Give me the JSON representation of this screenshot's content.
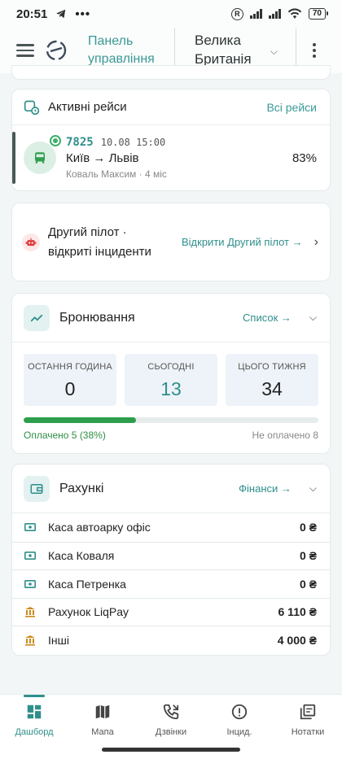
{
  "status_bar": {
    "time": "20:51",
    "battery": "70"
  },
  "header": {
    "tab_label": "Панель управління",
    "country": "Велика Британія"
  },
  "active_trips": {
    "title": "Активні рейси",
    "link": "Всі рейси",
    "trip": {
      "number": "7825",
      "datetime": "10.08 15:00",
      "route": "Київ → Львів",
      "driver": "Коваль Максим · 4 міс",
      "percent": "83%"
    }
  },
  "copilot": {
    "text": "Другий пілот · відкриті інциденти",
    "link": "Відкрити Другий пілот →"
  },
  "bookings": {
    "title": "Бронювання",
    "link": "Список →",
    "stats": [
      {
        "label": "ОСТАННЯ ГОДИНА",
        "value": "0"
      },
      {
        "label": "СЬОГОДНІ",
        "value": "13"
      },
      {
        "label": "ЦЬОГО ТИЖНЯ",
        "value": "34"
      }
    ],
    "paid_fraction": 0.38,
    "paid_label": "Оплачено 5 (38%)",
    "unpaid_label": "Не оплачено 8"
  },
  "accounts": {
    "title": "Рахункі",
    "link": "Фінанси →",
    "items": [
      {
        "name": "Каса автоарку офіс",
        "amount": "0 ₴",
        "icon": "cash-icon"
      },
      {
        "name": "Каса Коваля",
        "amount": "0 ₴",
        "icon": "cash-icon"
      },
      {
        "name": "Каса Петренка",
        "amount": "0 ₴",
        "icon": "cash-icon"
      },
      {
        "name": "Рахунок LiqPay",
        "amount": "6 110 ₴",
        "icon": "bank-icon"
      },
      {
        "name": "Інші",
        "amount": "4 000 ₴",
        "icon": "bank-icon"
      }
    ]
  },
  "bottom_nav": [
    {
      "label": "Дашборд",
      "active": true
    },
    {
      "label": "Мапа"
    },
    {
      "label": "Дзвінки"
    },
    {
      "label": "Інцид."
    },
    {
      "label": "Нотатки"
    }
  ],
  "colors": {
    "accent": "#2f8f8b",
    "paid": "#2e9e4c",
    "background": "#f2f6f6"
  }
}
